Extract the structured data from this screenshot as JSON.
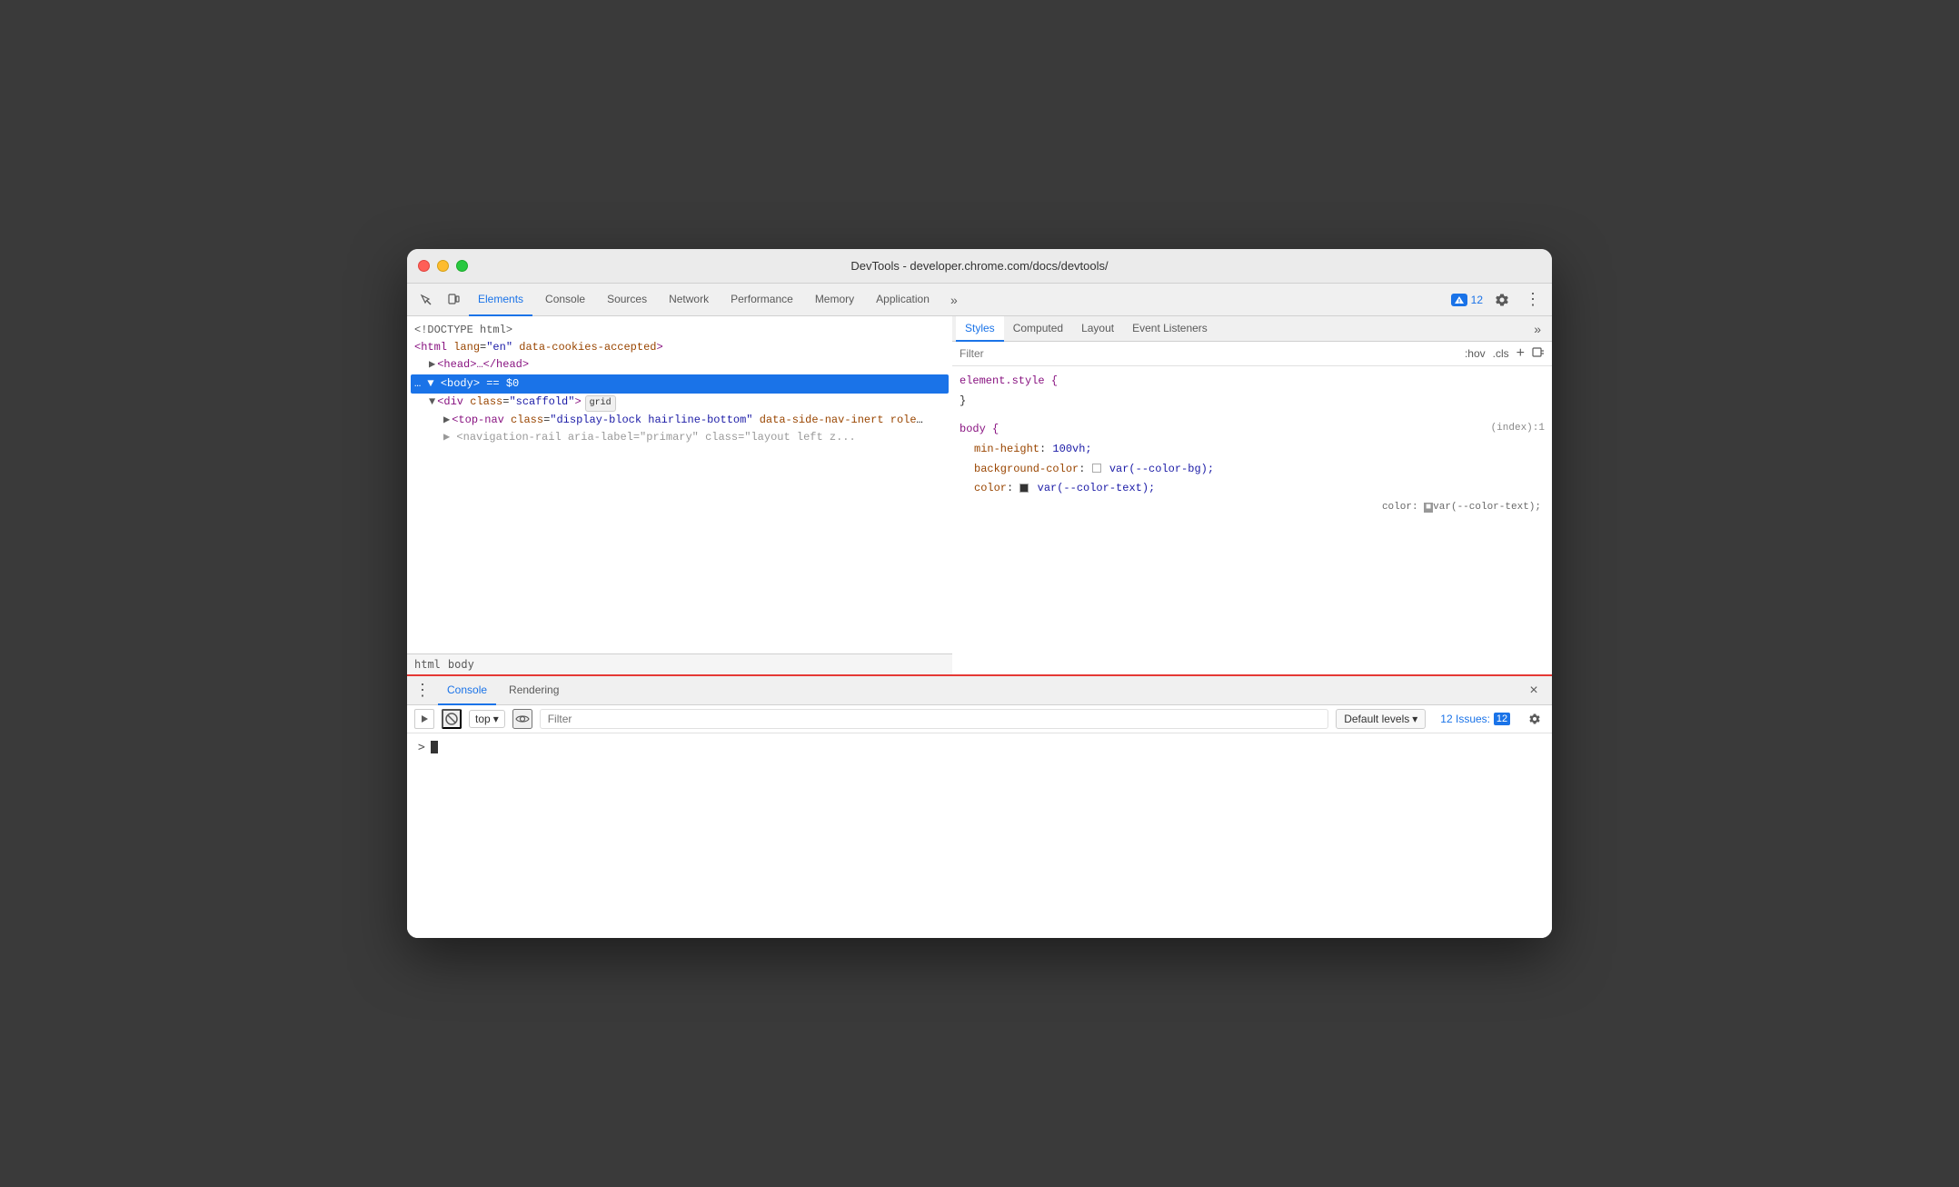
{
  "window": {
    "title": "DevTools - developer.chrome.com/docs/devtools/"
  },
  "toolbar": {
    "tabs": [
      {
        "label": "Elements",
        "active": true
      },
      {
        "label": "Console",
        "active": false
      },
      {
        "label": "Sources",
        "active": false
      },
      {
        "label": "Network",
        "active": false
      },
      {
        "label": "Performance",
        "active": false
      },
      {
        "label": "Memory",
        "active": false
      },
      {
        "label": "Application",
        "active": false
      }
    ],
    "more_label": "»",
    "issues_count": "12",
    "issues_label": "12"
  },
  "dom": {
    "lines": [
      {
        "text": "<!DOCTYPE html>",
        "indent": 0,
        "type": "doctype"
      },
      {
        "text": "<html lang=\"en\" data-cookies-accepted>",
        "indent": 0,
        "type": "tag"
      },
      {
        "text": "▶ <head>…</head>",
        "indent": 1,
        "type": "tag"
      },
      {
        "text": "▼ <body> == $0",
        "indent": 0,
        "type": "tag",
        "selected": true
      },
      {
        "text": "▼ <div class=\"scaffold\"> grid",
        "indent": 1,
        "type": "tag"
      },
      {
        "text": "▶ <top-nav class=\"display-block hairline-bottom\" data-side-nav-inert role=\"banner\">…</top-nav>",
        "indent": 2,
        "type": "tag"
      },
      {
        "text": "▶ <navigation-rail aria-label=\"primary\" class=\"layout left z...",
        "indent": 2,
        "type": "tag"
      }
    ],
    "breadcrumbs": [
      "html",
      "body"
    ]
  },
  "styles": {
    "tabs": [
      {
        "label": "Styles",
        "active": true
      },
      {
        "label": "Computed",
        "active": false
      },
      {
        "label": "Layout",
        "active": false
      },
      {
        "label": "Event Listeners",
        "active": false
      }
    ],
    "more_label": "»",
    "filter_placeholder": "Filter",
    "hov_label": ":hov",
    "cls_label": ".cls",
    "rules": [
      {
        "selector": "element.style {",
        "close": "}",
        "source": "",
        "properties": []
      },
      {
        "selector": "body {",
        "close": "}",
        "source": "(index):1",
        "properties": [
          {
            "prop": "min-height:",
            "value": "100vh;"
          },
          {
            "prop": "background-color:",
            "value": "var(--color-bg);",
            "swatch": true,
            "swatch_color": "white"
          },
          {
            "prop": "color:",
            "value": "var(--color-text);",
            "swatch": true,
            "swatch_color": "dark"
          }
        ]
      }
    ]
  },
  "console": {
    "tabs": [
      {
        "label": "Console",
        "active": true
      },
      {
        "label": "Rendering",
        "active": false
      }
    ],
    "top_label": "top",
    "filter_placeholder": "Filter",
    "default_levels_label": "Default levels",
    "issues_label": "12 Issues:",
    "issues_count": "12",
    "close_label": "×"
  }
}
